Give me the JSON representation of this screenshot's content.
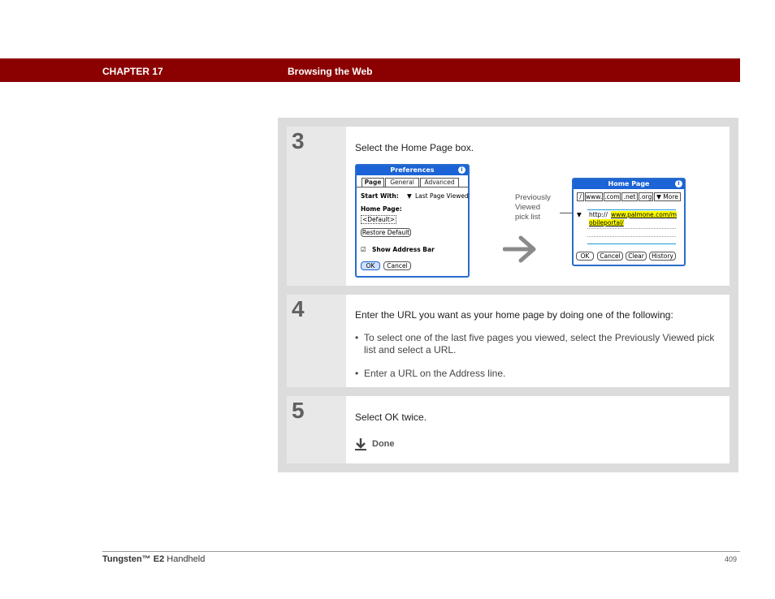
{
  "header": {
    "chapter": "CHAPTER 17",
    "title": "Browsing the Web"
  },
  "steps": [
    {
      "number": "3",
      "text": "Select the Home Page box."
    },
    {
      "number": "4",
      "text": "Enter the URL you want as your home page by doing one of the following:",
      "bullets": [
        "To select one of the last five pages you viewed, select the Previously Viewed pick list and select a URL.",
        "Enter a URL on the Address line."
      ]
    },
    {
      "number": "5",
      "text": "Select OK twice.",
      "done_label": "Done"
    }
  ],
  "prefs_screen": {
    "title": "Preferences",
    "info": "i",
    "tabs": [
      "Page",
      "General",
      "Advanced"
    ],
    "start_with_label": "Start With:",
    "start_with_value": "Last Page Viewed",
    "home_page_label": "Home Page:",
    "home_page_value": "<Default>",
    "restore_button": "Restore Default",
    "show_address_bar": "Show Address Bar",
    "check": "☑",
    "ok": "OK",
    "cancel": "Cancel"
  },
  "homepage_screen": {
    "title": "Home Page",
    "info": "i",
    "keys": [
      "/",
      "www.",
      ".com",
      ".net",
      ".org",
      "More"
    ],
    "url_prefix": "http://",
    "url_line1": "www.palmone.com/m",
    "url_line2": "obileportal/",
    "buttons": [
      "OK",
      "Cancel",
      "Clear",
      "History"
    ]
  },
  "callout": {
    "line1": "Previously",
    "line2": "Viewed",
    "line3": "pick list"
  },
  "footer": {
    "product_bold": "Tungsten™ E2",
    "product_rest": " Handheld",
    "page": "409"
  },
  "colors": {
    "header_bg": "#8b0000",
    "palm_title": "#1b63d6",
    "highlight": "#ffff00"
  }
}
